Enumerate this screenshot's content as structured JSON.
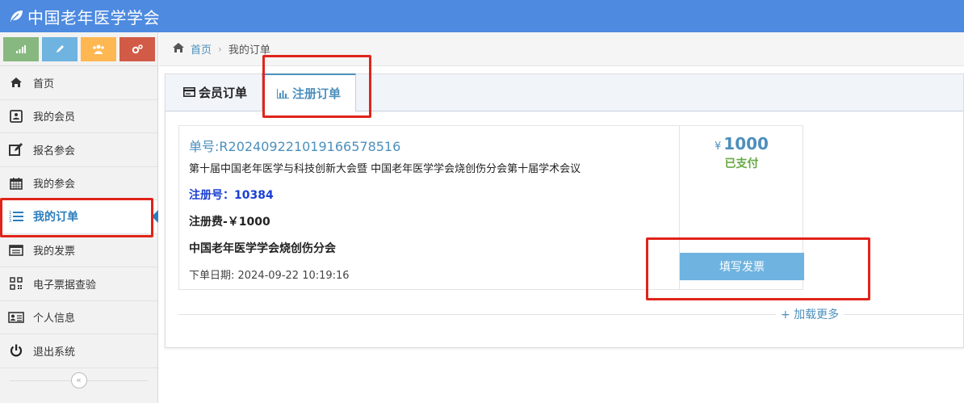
{
  "header": {
    "site_title": "中国老年医学学会"
  },
  "sidebar": {
    "shortcuts": [
      {
        "name": "stats",
        "color": "#87b87f"
      },
      {
        "name": "edit",
        "color": "#6fb3e0"
      },
      {
        "name": "users",
        "color": "#ffb752"
      },
      {
        "name": "settings",
        "color": "#d15b47"
      }
    ],
    "items": [
      {
        "label": "首页",
        "icon": "home-icon"
      },
      {
        "label": "我的会员",
        "icon": "member-card-icon"
      },
      {
        "label": "报名参会",
        "icon": "edit-register-icon"
      },
      {
        "label": "我的参会",
        "icon": "calendar-icon"
      },
      {
        "label": "我的订单",
        "icon": "list-icon",
        "active": true
      },
      {
        "label": "我的发票",
        "icon": "invoice-icon"
      },
      {
        "label": "电子票据查验",
        "icon": "qrcode-icon"
      },
      {
        "label": "个人信息",
        "icon": "profile-card-icon"
      },
      {
        "label": "退出系统",
        "icon": "power-icon"
      }
    ]
  },
  "breadcrumb": {
    "home": "首页",
    "current": "我的订单"
  },
  "tabs": [
    {
      "label": "会员订单",
      "active": false
    },
    {
      "label": "注册订单",
      "active": true
    }
  ],
  "order": {
    "order_no": "单号:R20240922101916657851​6",
    "description": "第十届中国老年医学与科技创新大会暨 中国老年医学学会烧创伤分会第十届学术会议",
    "reg_no": "注册号：10384",
    "reg_fee": "注册费-￥1000",
    "organization": "中国老年医学学会烧创伤分会",
    "order_date": "下单日期: 2024-09-22 10:19:16",
    "currency": "¥",
    "amount": "1000",
    "status": "已支付",
    "invoice_button": "填写发票"
  },
  "load_more": "+ 加载更多",
  "colors": {
    "header": "#4d8ae0",
    "accent": "#4c8fbd",
    "paid": "#69aa46",
    "annotation": "#e0241b"
  }
}
